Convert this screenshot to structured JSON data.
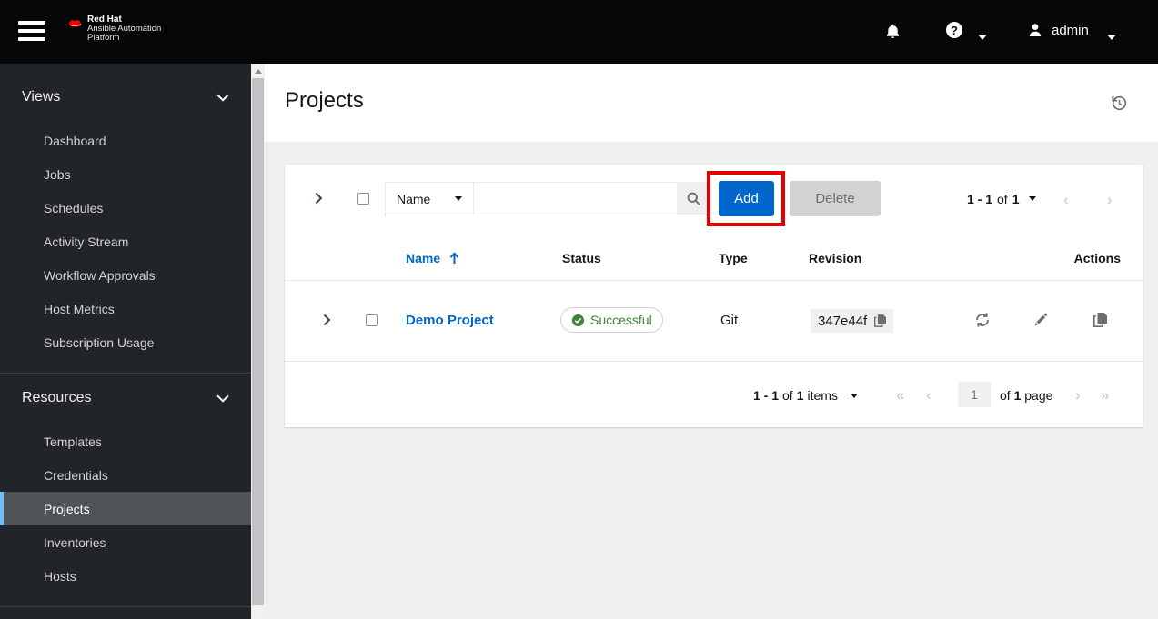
{
  "masthead": {
    "brand_line1": "Red Hat",
    "brand_line2": "Ansible Automation",
    "brand_line3": "Platform",
    "username": "admin"
  },
  "sidebar": {
    "groups": [
      {
        "label": "Views",
        "items": [
          "Dashboard",
          "Jobs",
          "Schedules",
          "Activity Stream",
          "Workflow Approvals",
          "Host Metrics",
          "Subscription Usage"
        ]
      },
      {
        "label": "Resources",
        "items": [
          "Templates",
          "Credentials",
          "Projects",
          "Inventories",
          "Hosts"
        ]
      }
    ],
    "active_item": "Projects"
  },
  "page": {
    "title": "Projects"
  },
  "toolbar": {
    "filter_attribute": "Name",
    "search_value": "",
    "add_label": "Add",
    "delete_label": "Delete",
    "pagination_range": "1 - 1",
    "pagination_of": "of",
    "pagination_total": "1"
  },
  "table": {
    "columns": [
      "Name",
      "Status",
      "Type",
      "Revision",
      "Actions"
    ],
    "rows": [
      {
        "name": "Demo Project",
        "status": "Successful",
        "type": "Git",
        "revision": "347e44f"
      }
    ]
  },
  "pagination": {
    "range": "1 - 1",
    "of": "of",
    "total": "1",
    "items_word": "items",
    "current_page": "1",
    "page_of": "of",
    "page_total": "1",
    "page_word": "page"
  },
  "colors": {
    "accent_blue": "#0066cc",
    "success_green": "#3e8635",
    "annotation_red": "#e60000",
    "brand_red": "#ee0000"
  }
}
